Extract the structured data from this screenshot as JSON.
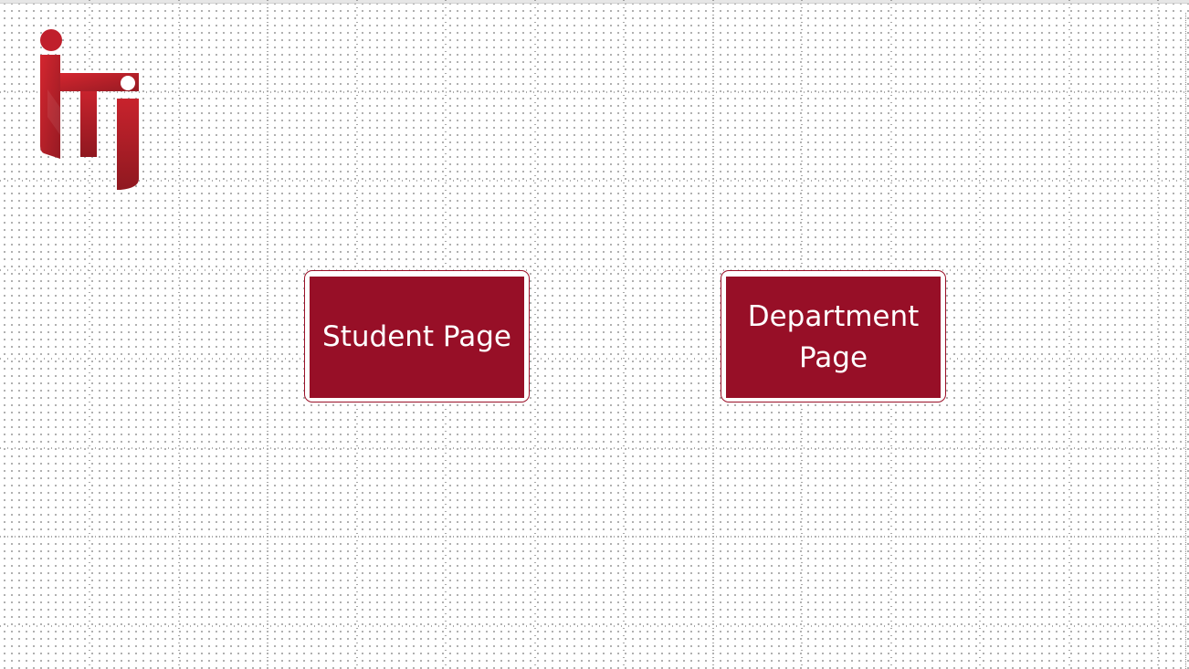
{
  "logo": {
    "icon": "iti-logo-icon",
    "color_primary": "#c01f2c",
    "color_dark": "#951a23"
  },
  "buttons": {
    "student_label": "Student Page",
    "department_label": "Department Page"
  },
  "colors": {
    "button_fill": "#970f27",
    "button_text": "#ffffff",
    "grid_dot": "#9a9a9a"
  }
}
